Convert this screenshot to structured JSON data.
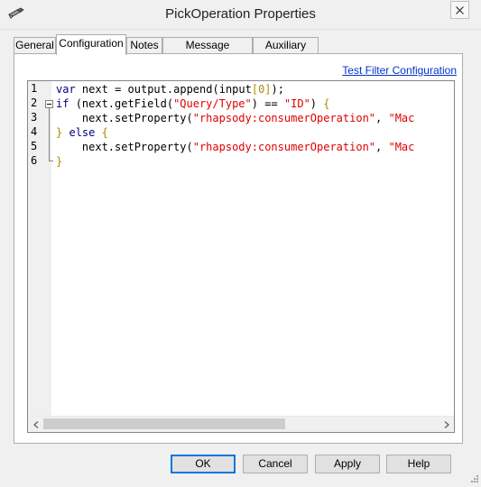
{
  "window": {
    "title": "PickOperation Properties",
    "app_icon": "pen-icon",
    "close_icon": "close-icon"
  },
  "tabs": [
    {
      "label": "General",
      "active": false
    },
    {
      "label": "Configuration",
      "active": true
    },
    {
      "label": "Notes",
      "active": false
    },
    {
      "label": "Message Collector",
      "active": false
    },
    {
      "label": "Auxiliary Files",
      "active": false
    }
  ],
  "panel": {
    "test_link": "Test Filter Configuration"
  },
  "editor": {
    "line_numbers": [
      "1",
      "2",
      "3",
      "4",
      "5",
      "6"
    ],
    "lines": [
      "var next = output.append(input[0]);",
      "if (next.getField(\"Query/Type\") == \"ID\") {",
      "    next.setProperty(\"rhapsody:consumerOperation\", \"Mac",
      "} else {",
      "    next.setProperty(\"rhapsody:consumerOperation\", \"Mac",
      "}"
    ],
    "colors": {
      "keyword": "#00007F",
      "string": "#E00000",
      "number": "#AD8A00"
    }
  },
  "buttons": {
    "ok": "OK",
    "cancel": "Cancel",
    "apply": "Apply",
    "help": "Help"
  }
}
